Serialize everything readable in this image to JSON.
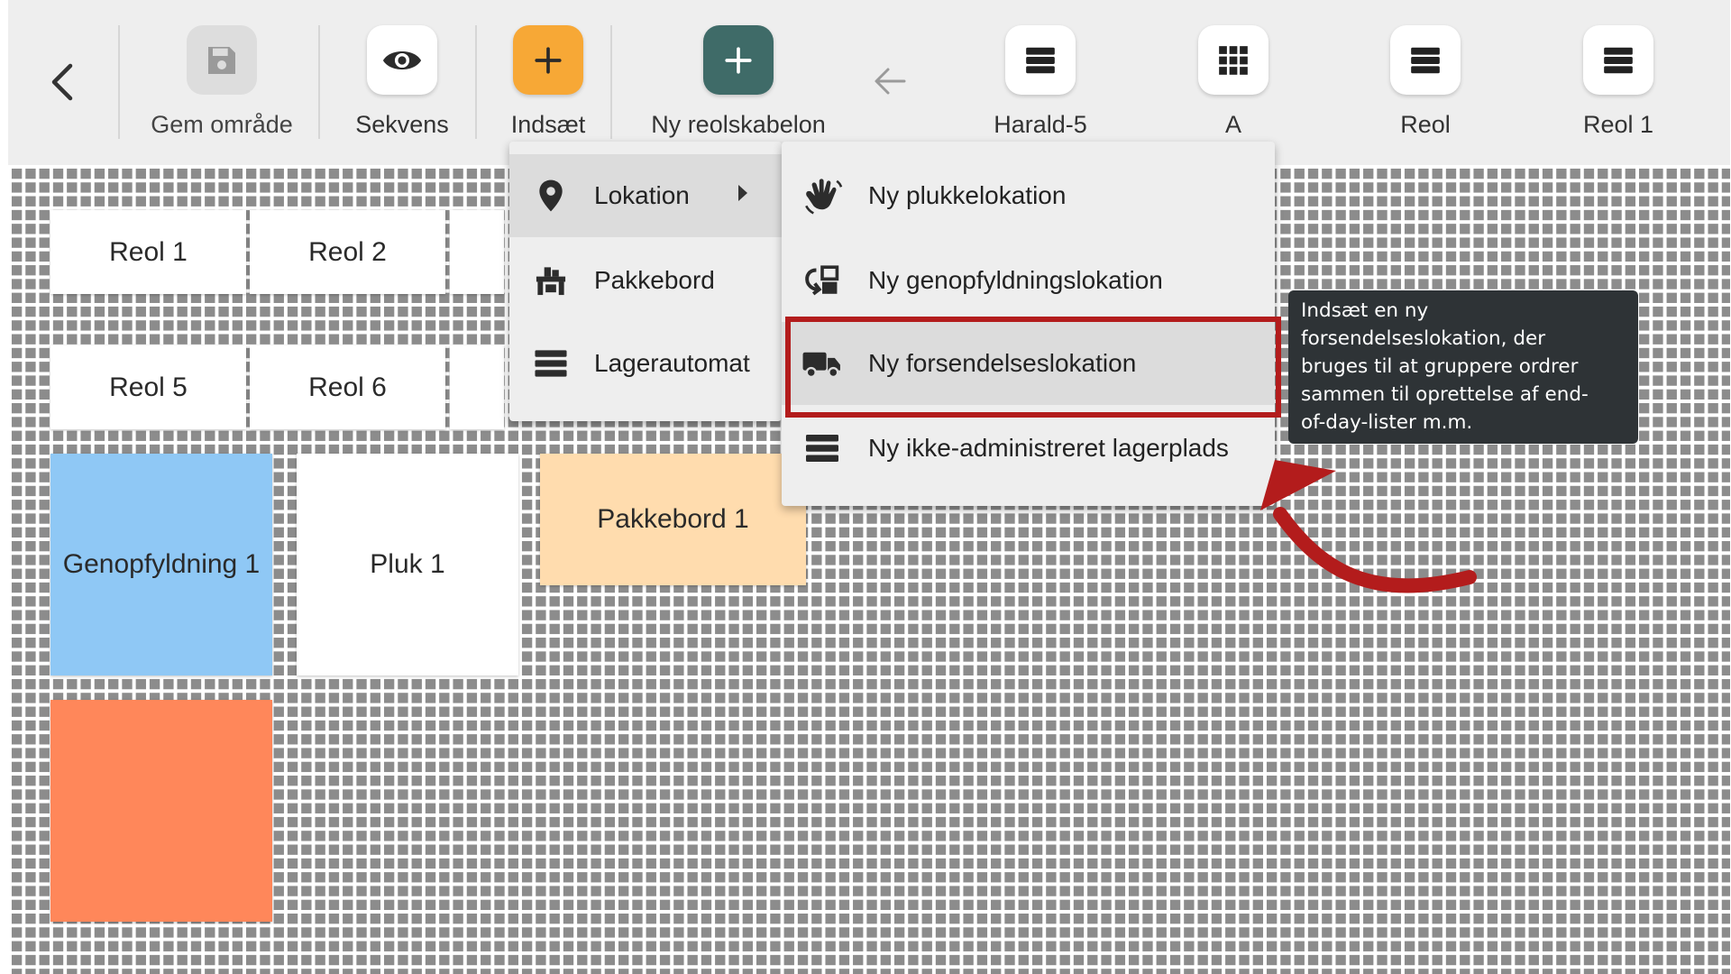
{
  "toolbar": {
    "save_label": "Gem område",
    "sequence_label": "Sekvens",
    "insert_label": "Indsæt",
    "new_template_label": "Ny reolskabelon",
    "templates": [
      {
        "label": "Harald-5",
        "icon": "list-icon"
      },
      {
        "label": "A",
        "icon": "grid-icon"
      },
      {
        "label": "Reol",
        "icon": "list-icon"
      },
      {
        "label": "Reol 1",
        "icon": "list-icon"
      }
    ]
  },
  "canvas": {
    "tiles": [
      "Reol 1",
      "Reol 2",
      "Reol 5",
      "Reol 6",
      "Genopfyldning 1",
      "Pluk 1",
      "Pakkebord 1",
      ""
    ]
  },
  "insert_menu": {
    "items": [
      {
        "label": "Lokation",
        "icon": "location-pin-icon"
      },
      {
        "label": "Pakkebord",
        "icon": "packing-table-icon"
      },
      {
        "label": "Lagerautomat",
        "icon": "storage-automat-icon"
      }
    ]
  },
  "location_submenu": {
    "items": [
      {
        "label": "Ny plukkelokation",
        "icon": "hand-pick-icon"
      },
      {
        "label": "Ny genopfyldningslokation",
        "icon": "replenish-icon"
      },
      {
        "label": "Ny forsendelseslokation",
        "icon": "truck-icon"
      },
      {
        "label": "Ny ikke-administreret lagerplads",
        "icon": "list-icon"
      }
    ]
  },
  "tooltip": {
    "lines": [
      "Indsæt en ny",
      "forsendelseslokation, der",
      "bruges til at gruppere ordrer",
      "sammen til oprettelse af end-",
      "of-day-lister m.m."
    ]
  },
  "colors": {
    "insert_accent": "#f7a836",
    "new_template_accent": "#3f6b68",
    "tile_blue": "#8fc8f5",
    "tile_peach": "#ffdcae",
    "tile_orange": "#ff875a",
    "annotation_red": "#b31c1c"
  }
}
